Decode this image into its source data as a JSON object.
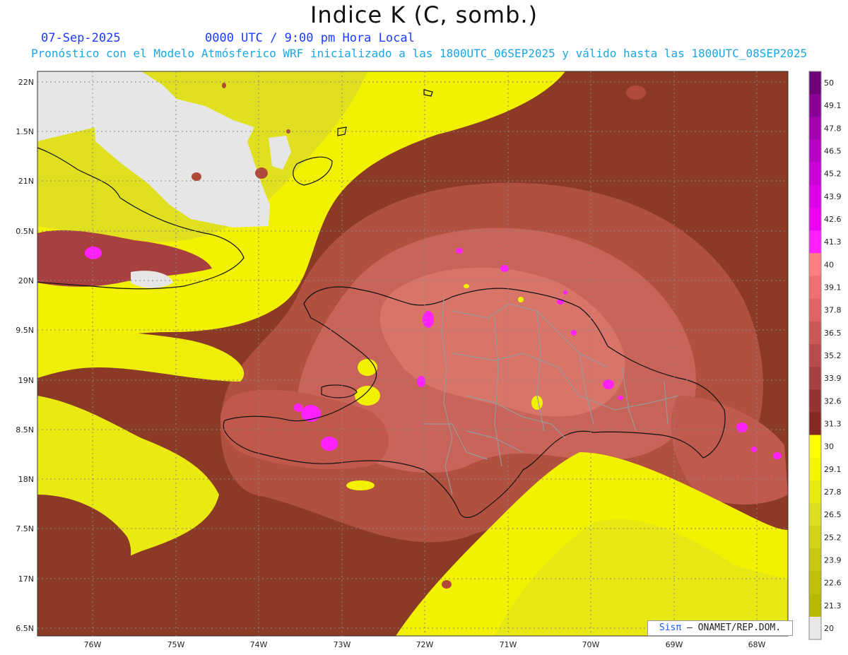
{
  "header": {
    "title": "Indice K (C, somb.)",
    "date": "07-Sep-2025",
    "time": "0000 UTC / 9:00 pm Hora Local",
    "subtitle": "Pronóstico con el Modelo Atmósferico WRF inicializado a las 1800UTC_06SEP2025 y válido hasta las  1800UTC_08SEP2025"
  },
  "credit": {
    "brand": "Sisπ",
    "text": "– ONAMET/REP.DOM."
  },
  "axes": {
    "lat_labels": [
      "22N",
      "1.5N",
      "21N",
      "0.5N",
      "20N",
      "9.5N",
      "19N",
      "8.5N",
      "18N",
      "7.5N",
      "17N",
      "6.5N"
    ],
    "lon_labels": [
      "76W",
      "75W",
      "74W",
      "73W",
      "72W",
      "71W",
      "70W",
      "69W",
      "68W"
    ]
  },
  "colorbar": {
    "labels": [
      "50",
      "49.1",
      "47.8",
      "46.5",
      "45.2",
      "43.9",
      "42.6",
      "41.3",
      "40",
      "39.1",
      "37.8",
      "36.5",
      "35.2",
      "33.9",
      "32.6",
      "31.3",
      "30",
      "29.1",
      "27.8",
      "26.5",
      "25.2",
      "23.9",
      "22.6",
      "21.3",
      "20"
    ],
    "colors": [
      "#6e0078",
      "#8a0096",
      "#a300b0",
      "#b800c4",
      "#cc00d8",
      "#de00e8",
      "#ee00f4",
      "#ff20ff",
      "#ff8080",
      "#f07070",
      "#e06464",
      "#cc5858",
      "#b84c4c",
      "#a84040",
      "#963434",
      "#842a22",
      "#ffff00",
      "#f5f500",
      "#eaea10",
      "#dede20",
      "#d2d218",
      "#c8c810",
      "#c0c008",
      "#b8b800",
      "#e8e8e8"
    ]
  },
  "colors": {
    "brown": "#8b3a26",
    "salmon": "#c8645a",
    "pink": "#e88080",
    "magenta": "#ff00ff",
    "yellow": "#ffff00",
    "olive": "#d8d830",
    "gray": "#e6e6e6",
    "border": "#9a9a9a"
  }
}
